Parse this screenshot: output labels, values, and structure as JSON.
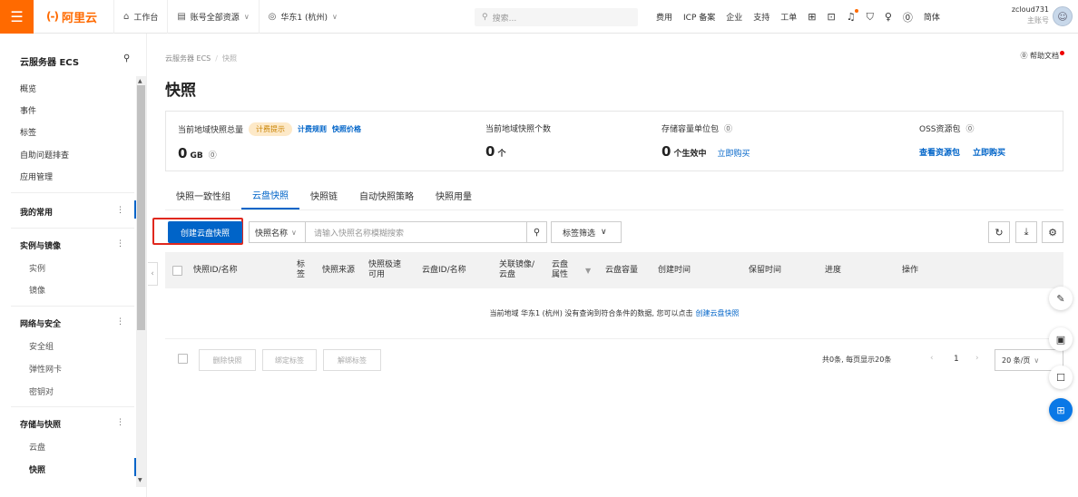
{
  "colors": {
    "brand": "#ff6a00",
    "primary": "#0064c8",
    "highlight": "#e0281e"
  },
  "topbar": {
    "menu_icon": "hamburger-icon",
    "logo_mark": "(-)",
    "logo_text": "阿里云",
    "nav": [
      {
        "icon": "home-icon",
        "label": "工作台"
      },
      {
        "icon": "account-icon",
        "label": "账号全部资源"
      },
      {
        "icon": "location-icon",
        "label": "华东1 (杭州)"
      }
    ],
    "search_placeholder": "搜索...",
    "links": [
      "费用",
      "ICP 备案",
      "企业",
      "支持",
      "工单"
    ],
    "icons": [
      "app-icon",
      "terminal-icon",
      "bell-icon",
      "cart-icon",
      "bulb-icon",
      "help-icon"
    ],
    "lang": "简体",
    "account_name": "zcloud731",
    "account_role": "主账号"
  },
  "sidebar": {
    "title": "云服务器 ECS",
    "top_items": [
      "概览",
      "事件",
      "标签",
      "自助问题排查",
      "应用管理"
    ],
    "groups": [
      {
        "label": "我的常用",
        "subs": []
      },
      {
        "label": "实例与镜像",
        "subs": [
          "实例",
          "镜像"
        ]
      },
      {
        "label": "网络与安全",
        "subs": [
          "安全组",
          "弹性网卡",
          "密钥对"
        ]
      },
      {
        "label": "存储与快照",
        "subs": [
          "云盘",
          "快照"
        ]
      }
    ]
  },
  "main": {
    "breadcrumb": [
      "云服务器 ECS",
      "快照"
    ],
    "help": "帮助文档",
    "title": "快照",
    "stats": {
      "total": {
        "label": "当前地域快照总量",
        "badge": "计费提示",
        "link1": "计费规则",
        "link2": "快照价格",
        "value": "0",
        "unit": "GB"
      },
      "count": {
        "label": "当前地域快照个数",
        "value": "0",
        "unit": "个"
      },
      "capacity": {
        "label": "存储容量单位包",
        "value": "0",
        "unit": "个生效中",
        "link": "立即购买"
      },
      "oss": {
        "label": "OSS资源包",
        "link1": "查看资源包",
        "link2": "立即购买"
      }
    },
    "tabs": [
      "快照一致性组",
      "云盘快照",
      "快照链",
      "自动快照策略",
      "快照用量"
    ],
    "active_tab": "云盘快照",
    "toolbar": {
      "create": "创建云盘快照",
      "filter_select": "快照名称",
      "search_placeholder": "请输入快照名称模糊搜索",
      "tag_filter": "标签筛选"
    },
    "columns": [
      "快照ID/名称",
      "标签",
      "快照来源",
      "快照极速可用",
      "云盘ID/名称",
      "关联镜像/云盘",
      "云盘属性",
      "云盘容量",
      "创建时间",
      "保留时间",
      "进度",
      "操作"
    ],
    "empty": {
      "text": "当前地域 华东1 (杭州) 没有查询到符合条件的数据, 您可以点击",
      "link": "创建云盘快照"
    },
    "footer": {
      "delete": "删除快照",
      "bind_tag": "绑定标签",
      "unbind_tag": "解绑标签",
      "pagination_info": "共0条, 每页显示20条",
      "page": "1",
      "page_size": "20 条/页"
    }
  }
}
